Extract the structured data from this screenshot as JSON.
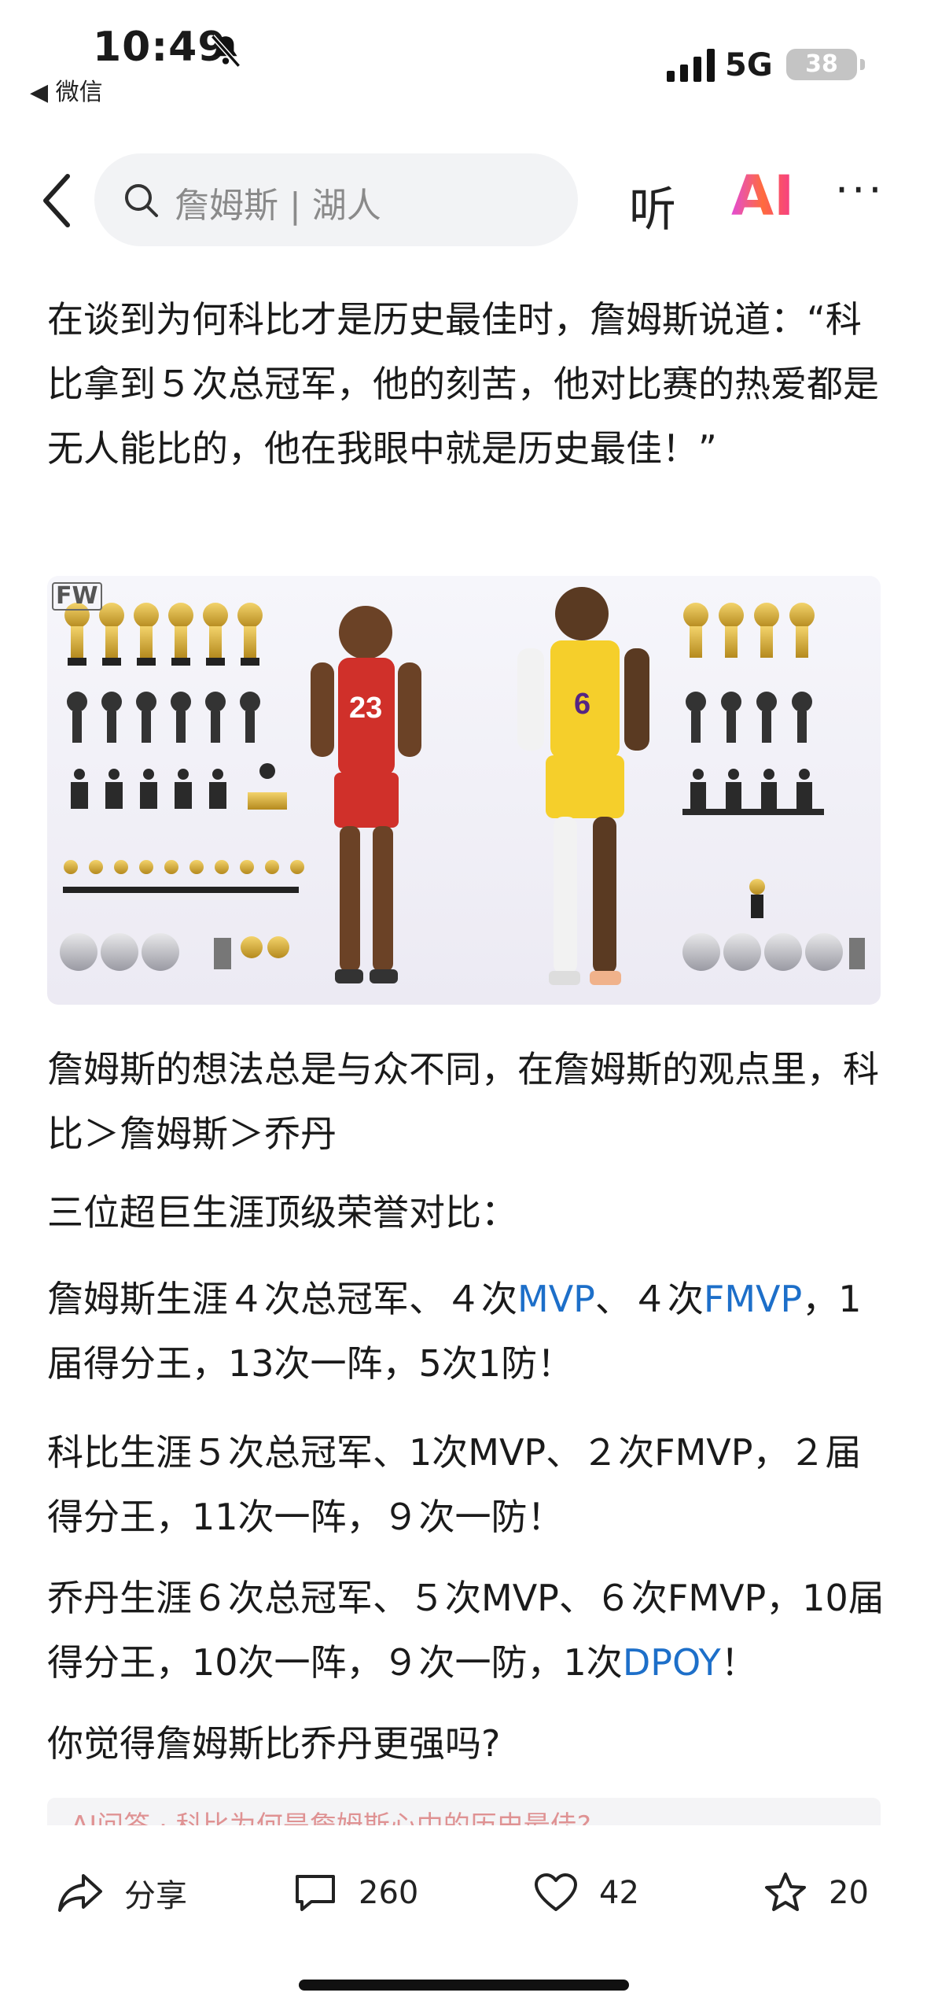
{
  "status_bar": {
    "time": "10:49",
    "back_app": "◀ 微信",
    "network": "5G",
    "battery": "38"
  },
  "nav": {
    "search_text": "詹姆斯 | 湖人",
    "listen_label": "听",
    "ai_label": "AI",
    "more_label": "···"
  },
  "article": {
    "p1": "在谈到为何科比才是历史最佳时，詹姆斯说道：“科比拿到５次总冠军，他的刻苦，他对比赛的热爱都是无人能比的，他在我眼中就是历史最佳！”",
    "image_watermark": "FW",
    "p2": "詹姆斯的想法总是与众不同，在詹姆斯的观点里，科比＞詹姆斯＞乔丹",
    "p3": "三位超巨生涯顶级荣誉对比：",
    "p4_a": "詹姆斯生涯４次总冠军、４次",
    "p4_link1": "MVP",
    "p4_b": "、４次",
    "p4_link2": "FMVP",
    "p4_c": "，1届得分王，13次一阵，5次1防！",
    "p5": "科比生涯５次总冠军、1次MVP、２次FMVP，２届得分王，11次一阵，９次一防！",
    "p6_a": "乔丹生涯６次总冠军、５次MVP、６次FMVP，10届得分王，10次一阵，９次一防，1次",
    "p6_link": "DPOY",
    "p6_b": "！",
    "p7": "你觉得詹姆斯比乔丹更强吗?",
    "related_peek": "AI问答 · 科比为何是詹姆斯心中的历史最佳?"
  },
  "actions": {
    "share": "分享",
    "comments": "260",
    "likes": "42",
    "favorites": "20"
  },
  "colors": {
    "link": "#1d6fc9",
    "search_bg": "#f2f3f5",
    "bulls_red": "#d0302a",
    "lakers_gold": "#f5cf2b"
  }
}
